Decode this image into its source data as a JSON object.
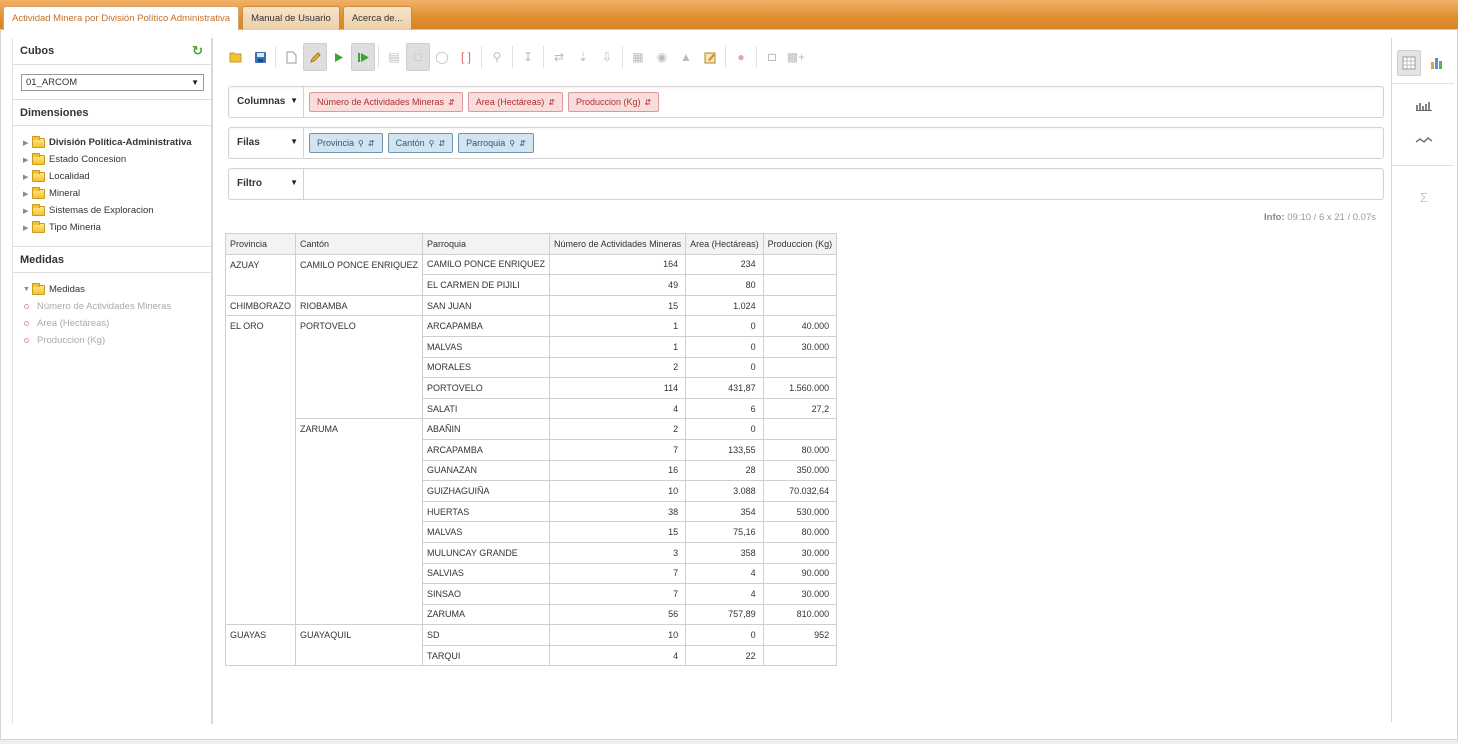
{
  "tabs": [
    {
      "label": "Actividad Minera por División Político Administrativa",
      "active": true
    },
    {
      "label": "Manual de Usuario",
      "active": false
    },
    {
      "label": "Acerca de...",
      "active": false
    }
  ],
  "sidebar": {
    "cubes_title": "Cubos",
    "cube_selected": "01_ARCOM",
    "dimensions_title": "Dimensiones",
    "dimensions": [
      "División Política-Administrativa",
      "Estado Concesion",
      "Localidad",
      "Mineral",
      "Sistemas de Exploracion",
      "Tipo Mineria"
    ],
    "measures_title": "Medidas",
    "measures_folder": "Medidas",
    "measures": [
      "Número de Actividades Mineras",
      "Area (Hectáreas)",
      "Produccion (Kg)"
    ]
  },
  "query": {
    "columns_label": "Columnas",
    "columns": [
      "Número de Actividades Mineras",
      "Area (Hectáreas)",
      "Produccion (Kg)"
    ],
    "rows_label": "Filas",
    "rows": [
      "Provincia",
      "Cantón",
      "Parroquia"
    ],
    "filter_label": "Filtro"
  },
  "info": {
    "label": "Info:",
    "value": "09:10  / 6 x 21  / 0.07s"
  },
  "table": {
    "headers": [
      "Provincia",
      "Cantón",
      "Parroquia",
      "Número de Actividades Mineras",
      "Area (Hectáreas)",
      "Produccion (Kg)"
    ],
    "provinces": [
      {
        "name": "AZUAY",
        "cantons": [
          {
            "name": "CAMILO PONCE ENRIQUEZ",
            "rows": [
              [
                "CAMILO PONCE ENRIQUEZ",
                "164",
                "234",
                ""
              ],
              [
                "EL CARMEN DE PIJILI",
                "49",
                "80",
                ""
              ]
            ]
          }
        ]
      },
      {
        "name": "CHIMBORAZO",
        "cantons": [
          {
            "name": "RIOBAMBA",
            "rows": [
              [
                "SAN JUAN",
                "15",
                "1.024",
                ""
              ]
            ]
          }
        ]
      },
      {
        "name": "EL ORO",
        "cantons": [
          {
            "name": "PORTOVELO",
            "rows": [
              [
                "ARCAPAMBA",
                "1",
                "0",
                "40.000"
              ],
              [
                "MALVAS",
                "1",
                "0",
                "30.000"
              ],
              [
                "MORALES",
                "2",
                "0",
                ""
              ],
              [
                "PORTOVELO",
                "114",
                "431,87",
                "1.560.000"
              ],
              [
                "SALATI",
                "4",
                "6",
                "27,2"
              ]
            ]
          },
          {
            "name": "ZARUMA",
            "rows": [
              [
                "ABAÑIN",
                "2",
                "0",
                ""
              ],
              [
                "ARCAPAMBA",
                "7",
                "133,55",
                "80.000"
              ],
              [
                "GUANAZAN",
                "16",
                "28",
                "350.000"
              ],
              [
                "GUIZHAGUIÑA",
                "10",
                "3.088",
                "70.032,64"
              ],
              [
                "HUERTAS",
                "38",
                "354",
                "530.000"
              ],
              [
                "MALVAS",
                "15",
                "75,16",
                "80.000"
              ],
              [
                "MULUNCAY GRANDE",
                "3",
                "358",
                "30.000"
              ],
              [
                "SALVIAS",
                "7",
                "4",
                "90.000"
              ],
              [
                "SINSAO",
                "7",
                "4",
                "30.000"
              ],
              [
                "ZARUMA",
                "56",
                "757,89",
                "810.000"
              ]
            ]
          }
        ]
      },
      {
        "name": "GUAYAS",
        "cantons": [
          {
            "name": "GUAYAQUIL",
            "rows": [
              [
                "SD",
                "10",
                "0",
                "952"
              ],
              [
                "TARQUI",
                "4",
                "22",
                ""
              ]
            ]
          }
        ]
      }
    ]
  },
  "right_panel": {
    "sum_symbol": "Σ"
  },
  "colors": {
    "accent_orange": "#e08f30",
    "tab_active_text": "#c0712a",
    "measure_chip": "#f9dcdc",
    "dimension_chip": "#d3e4ef"
  }
}
